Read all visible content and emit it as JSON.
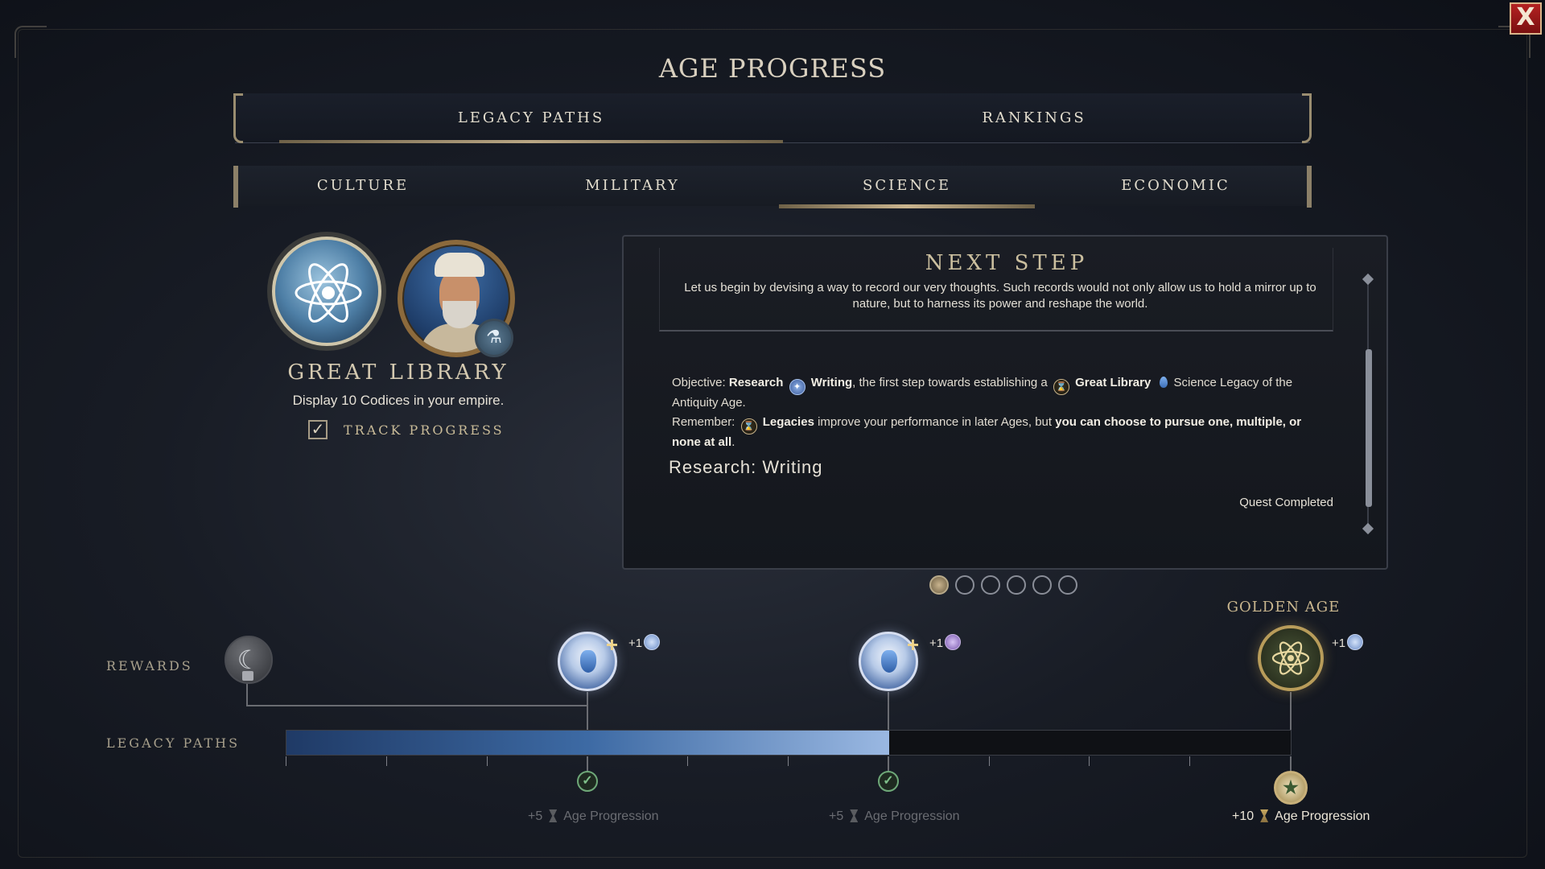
{
  "window": {
    "title": "AGE PROGRESS",
    "close_label": "X"
  },
  "main_tabs": [
    {
      "label": "LEGACY PATHS",
      "active": true
    },
    {
      "label": "RANKINGS",
      "active": false
    }
  ],
  "sub_tabs": [
    {
      "label": "CULTURE",
      "active": false
    },
    {
      "label": "MILITARY",
      "active": false
    },
    {
      "label": "SCIENCE",
      "active": true
    },
    {
      "label": "ECONOMIC",
      "active": false
    }
  ],
  "legacy": {
    "name": "GREAT LIBRARY",
    "description": "Display 10 Codices in your empire.",
    "track_label": "TRACK PROGRESS",
    "track_checked": true
  },
  "next_step": {
    "title": "NEXT STEP",
    "quote": "Let us begin by devising a way to record our very thoughts. Such records would not only allow us to hold a mirror up to nature, but to harness its power and reshape the world.",
    "objective": {
      "prefix": "Objective:",
      "research_word": "Research",
      "tech": "Writing",
      "mid": ", the first step towards establishing a",
      "legacy": "Great Library",
      "suffix": "Science Legacy of the Antiquity Age."
    },
    "remember": {
      "prefix": "Remember:",
      "legacies": "Legacies",
      "mid": "improve your performance in later Ages, but",
      "bold_end": "you can choose to pursue one, multiple, or none at all",
      "end": "."
    },
    "research_label": "Research: Writing",
    "status": "Quest Completed",
    "page_count": 6,
    "page_active": 1
  },
  "track": {
    "rewards_label": "REWARDS",
    "legacy_paths_label": "LEGACY PATHS",
    "golden_age_label": "GOLDEN AGE",
    "progress_fraction": 0.6,
    "rewards": [
      {
        "bonus": "+1",
        "icon": "science-codex-icon"
      },
      {
        "bonus": "+1",
        "icon": "purple-codex-icon"
      },
      {
        "bonus": "+1",
        "icon": "science-codex-icon"
      }
    ],
    "milestones": [
      {
        "amount": "+5",
        "label": "Age Progression",
        "done": true
      },
      {
        "amount": "+5",
        "label": "Age Progression",
        "done": true
      },
      {
        "amount": "+10",
        "label": "Age Progression",
        "done": false
      }
    ]
  }
}
